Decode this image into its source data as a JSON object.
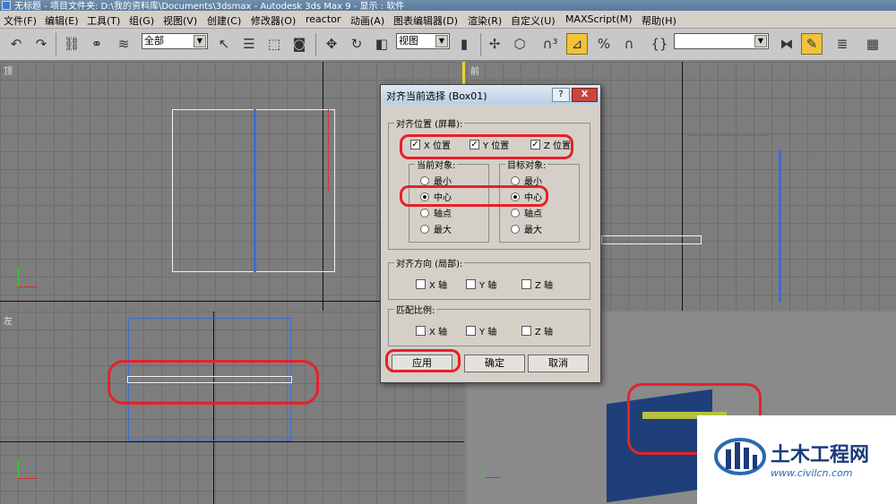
{
  "titlebar": {
    "text": "无标题    - 项目文件夹: D:\\我的资料库\\Documents\\3dsmax         - Autodesk 3ds Max 9          - 显示 : 软件"
  },
  "menu": [
    "文件(F)",
    "编辑(E)",
    "工具(T)",
    "组(G)",
    "视图(V)",
    "创建(C)",
    "修改器(O)",
    "reactor",
    "动画(A)",
    "图表编辑器(D)",
    "渲染(R)",
    "自定义(U)",
    "MAXScript(M)",
    "帮助(H)"
  ],
  "toolbar": {
    "selection_filter": "全部",
    "reference_coord": "视图",
    "named_selection": ""
  },
  "viewports": {
    "top": "顶",
    "front": "前",
    "left": "左",
    "perspective": ""
  },
  "dialog": {
    "title": "对齐当前选择 (Box01)",
    "help": "?",
    "close": "X",
    "align_position": {
      "label": "对齐位置 (屏幕):",
      "x": "X 位置",
      "y": "Y 位置",
      "z": "Z 位置"
    },
    "current_object": {
      "label": "当前对象:",
      "options": [
        "最小",
        "中心",
        "轴点",
        "最大"
      ]
    },
    "target_object": {
      "label": "目标对象:",
      "options": [
        "最小",
        "中心",
        "轴点",
        "最大"
      ]
    },
    "align_orientation": {
      "label": "对齐方向 (局部):",
      "x": "X 轴",
      "y": "Y 轴",
      "z": "Z 轴"
    },
    "match_scale": {
      "label": "匹配比例:",
      "x": "X 轴",
      "y": "Y 轴",
      "z": "Z 轴"
    },
    "buttons": {
      "apply": "应用",
      "ok": "确定",
      "cancel": "取消"
    }
  },
  "watermark": {
    "cn": "土木工程网",
    "url": "www.civilcn.com"
  },
  "colors": {
    "highlight_red": "#e8202a",
    "active_viewport": "#e8d23a",
    "object_blue": "#1f3f7a"
  }
}
